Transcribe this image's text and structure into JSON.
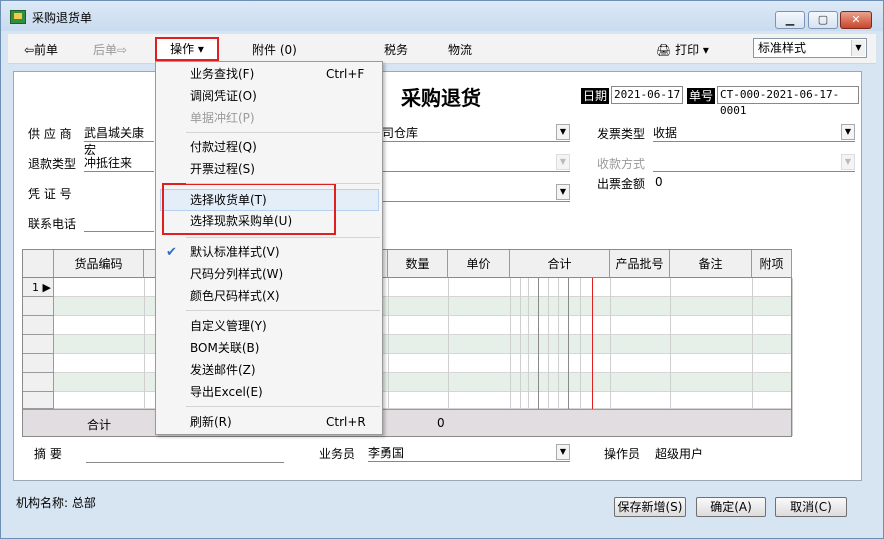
{
  "window": {
    "title": "采购退货单"
  },
  "toolbar": {
    "prev": "⇦前单",
    "next": "后单⇨",
    "ops": "操作 ▾",
    "attach": "附件 (0)",
    "tax": "税务",
    "logistics": "物流",
    "print": "打印 ▾",
    "style_select": "标准样式"
  },
  "form": {
    "title": "采购退货",
    "date_label": "日期",
    "date_value": "2021-06-17",
    "no_label": "单号",
    "no_value": "CT-000-2021-06-17-0001",
    "supplier_label": "供 应 商",
    "supplier_value": "武昌城关康宏",
    "warehouse_partial": "司仓库",
    "refund_type_label": "退款类型",
    "refund_type_value": "冲抵往来",
    "voucher_label": "凭 证 号",
    "phone_label": "联系电话",
    "invoice_type_label": "发票类型",
    "invoice_type_value": "收据",
    "pay_method_label": "收款方式",
    "invoice_amount_label": "出票金额",
    "invoice_amount_value": "0",
    "memo_label": "摘   要",
    "salesman_label": "业务员",
    "salesman_value": "李勇国",
    "operator_label": "操作员",
    "operator_value": "超级用户"
  },
  "grid": {
    "headers": [
      "货品编码",
      "数量",
      "单价",
      "合计",
      "产品批号",
      "备注",
      "附项"
    ],
    "first_row_index": "1",
    "total_label": "合计",
    "total_qty": "0"
  },
  "menu": {
    "items": [
      {
        "label": "业务查找(F)",
        "shortcut": "Ctrl+F",
        "disabled": false
      },
      {
        "label": "调阅凭证(O)",
        "shortcut": "",
        "disabled": false
      },
      {
        "label": "单据冲红(P)",
        "shortcut": "",
        "disabled": true
      },
      {
        "label": "付款过程(Q)",
        "shortcut": "",
        "disabled": false
      },
      {
        "label": "开票过程(S)",
        "shortcut": "",
        "disabled": false
      },
      {
        "label": "选择收货单(T)",
        "shortcut": "",
        "disabled": false
      },
      {
        "label": "选择现款采购单(U)",
        "shortcut": "",
        "disabled": false
      },
      {
        "label": "默认标准样式(V)",
        "shortcut": "",
        "disabled": false,
        "checked": true
      },
      {
        "label": "尺码分列样式(W)",
        "shortcut": "",
        "disabled": false
      },
      {
        "label": "颜色尺码样式(X)",
        "shortcut": "",
        "disabled": false
      },
      {
        "label": "自定义管理(Y)",
        "shortcut": "",
        "disabled": false
      },
      {
        "label": "BOM关联(B)",
        "shortcut": "",
        "disabled": false
      },
      {
        "label": "发送邮件(Z)",
        "shortcut": "",
        "disabled": false
      },
      {
        "label": "导出Excel(E)",
        "shortcut": "",
        "disabled": false
      },
      {
        "label": "刷新(R)",
        "shortcut": "Ctrl+R",
        "disabled": false
      }
    ]
  },
  "footer": {
    "org_label": "机构名称: 总部",
    "save_new": "保存新增(S)",
    "ok": "确定(A)",
    "cancel": "取消(C)"
  },
  "colors": {
    "highlight_red": "#e02020",
    "alt_row": "#e6efe8",
    "check_blue": "#2a6fc9"
  }
}
